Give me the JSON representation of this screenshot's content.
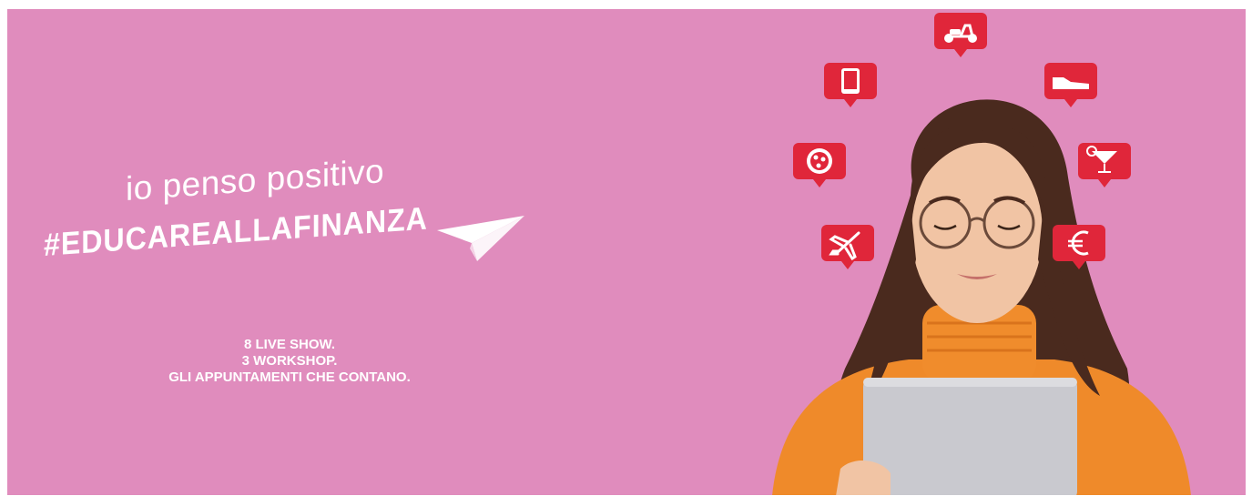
{
  "banner": {
    "tagline": "io penso positivo",
    "hashtag": "#EDUCAREALLAFINANZA",
    "events": [
      "8 LIVE SHOW.",
      "3 WORKSHOP.",
      "GLI APPUNTAMENTI CHE CONTANO."
    ]
  },
  "colors": {
    "background": "#e08cbd",
    "bubble": "#e0263a",
    "text": "#ffffff",
    "sweater": "#ef8a2a"
  },
  "icons": [
    "scooter-icon",
    "tablet-icon",
    "shoe-icon",
    "pizza-icon",
    "cocktail-icon",
    "airplane-icon",
    "euro-icon",
    "paper-plane-icon"
  ]
}
